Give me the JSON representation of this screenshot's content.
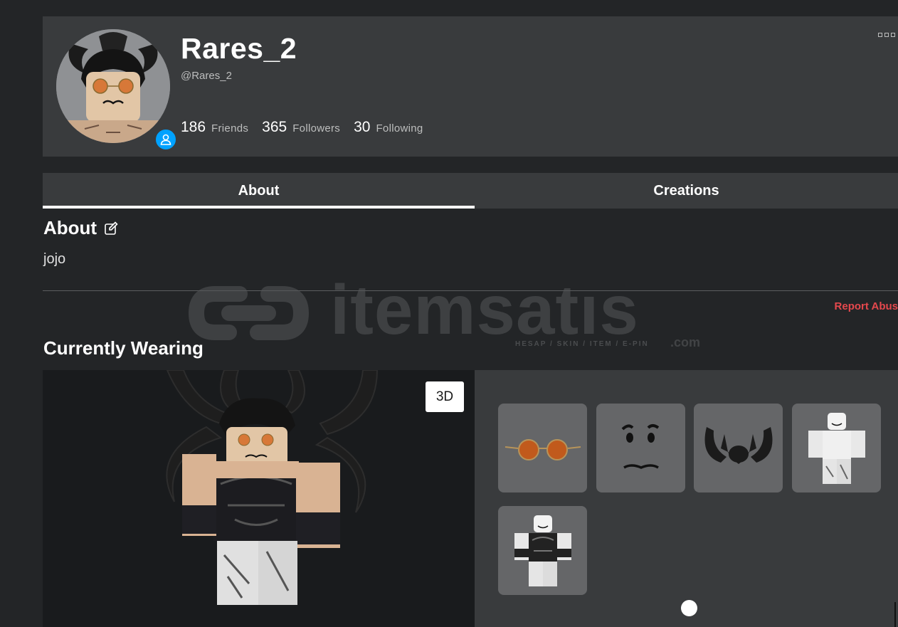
{
  "profile": {
    "display_name": "Rares_2",
    "username": "@Rares_2",
    "stats": [
      {
        "count": "186",
        "label": "Friends"
      },
      {
        "count": "365",
        "label": "Followers"
      },
      {
        "count": "30",
        "label": "Following"
      }
    ]
  },
  "tabs": [
    {
      "label": "About",
      "active": true
    },
    {
      "label": "Creations",
      "active": false
    }
  ],
  "about": {
    "heading": "About",
    "text": "jojo",
    "report_label": "Report Abus"
  },
  "wearing": {
    "heading": "Currently Wearing",
    "view_toggle_label": "3D",
    "items": [
      {
        "name": "Round Orange Sunglasses",
        "icon": "sunglasses-icon"
      },
      {
        "name": "Face",
        "icon": "face-icon"
      },
      {
        "name": "Dark Horns Headpiece",
        "icon": "horns-icon"
      },
      {
        "name": "White Shirt",
        "icon": "shirt-icon"
      },
      {
        "name": "Outfit",
        "icon": "outfit-icon"
      }
    ]
  },
  "watermark": {
    "text": "itemsatıs",
    "tagline": "HESAP / SKIN / ITEM / E-PIN",
    "suffix": ".com"
  },
  "colors": {
    "background": "#232527",
    "card": "#393b3d",
    "presence": "#00a2ff",
    "report": "#e5484d"
  }
}
